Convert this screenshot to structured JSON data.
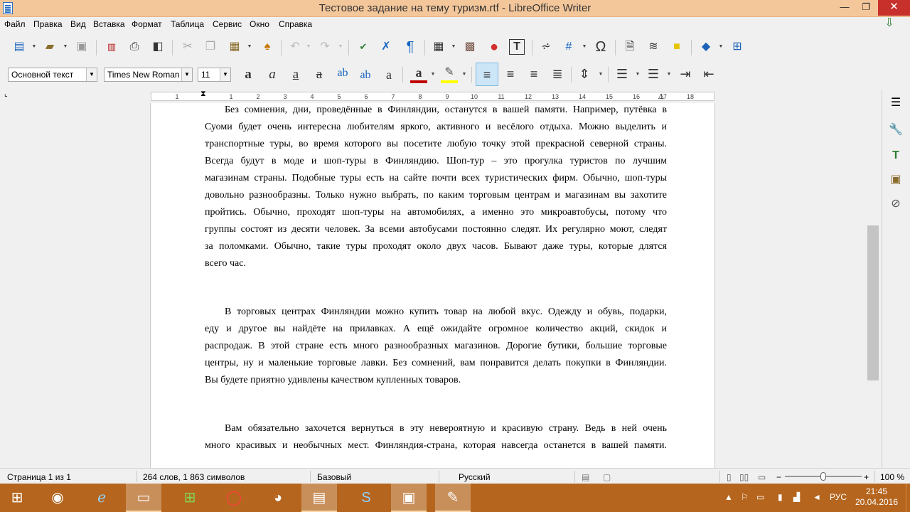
{
  "window": {
    "title": "Тестовое задание на тему туризм.rtf - LibreOffice Writer",
    "minimize_glyph": "—",
    "restore_glyph": "❐",
    "close_glyph": "✕"
  },
  "menu": [
    "Файл",
    "Правка",
    "Вид",
    "Вставка",
    "Формат",
    "Таблица",
    "Сервис",
    "Окно",
    "Справка"
  ],
  "toolbar": {
    "icons": [
      "new-icon",
      "open-icon",
      "save-icon",
      "export-pdf-icon",
      "print-icon",
      "print-preview-icon",
      "cut-icon",
      "copy-icon",
      "paste-icon",
      "clone-formatting-icon",
      "undo-icon",
      "redo-icon",
      "spellcheck-icon",
      "autocorrect-icon",
      "formatting-marks-icon",
      "table-icon",
      "image-icon",
      "chart-icon",
      "textbox-icon",
      "page-break-icon",
      "field-icon",
      "special-character-icon",
      "hyperlink-icon",
      "footnote-icon",
      "comment-icon",
      "track-changes-icon",
      "shapes-icon",
      "basic-shapes-icon"
    ]
  },
  "format": {
    "paragraph_style": "Основной текст",
    "font_name": "Times New Roman",
    "font_size": "11",
    "text_color": "#c00000",
    "highlight_color": "#ffff00"
  },
  "ruler": {
    "numbers": [
      "1",
      "1",
      "2",
      "3",
      "4",
      "5",
      "6",
      "7",
      "8",
      "9",
      "10",
      "11",
      "12",
      "13",
      "14",
      "15",
      "16",
      "17",
      "18"
    ]
  },
  "document": {
    "para1": [
      "Без сомнения, дни, проведённые в Финляндии, останутся в вашей памяти. Например, путёвка в",
      "Суоми будет очень интересна любителям яркого, активного и весёлого отдыха. Можно выделить и",
      "транспортные туры, во время которого вы посетите любую точку этой прекрасной северной страны.",
      "Всегда будут в моде и шоп-туры в Финляндию. Шоп-тур – это прогулка туристов по лучшим",
      "магазинам страны. Подобные туры есть на сайте почти всех туристических фирм. Обычно, шоп-туры",
      "довольно разнообразны. Только нужно выбрать, по каким торговым центрам и магазинам вы захотите",
      "пройтись. Обычно, проходят шоп-туры на автомобилях, а именно это микроавтобусы, потому что",
      "группы состоят из десяти человек. За всеми автобусами постоянно следят. Их регулярно моют, следят",
      "за поломками. Обычно, такие туры проходят около двух часов. Бывают даже туры, которые длятся",
      "всего час."
    ],
    "para2": [
      "В торговых центрах Финляндии можно купить товар на любой вкус. Одежду и обувь, подарки,",
      "еду и другое вы найдёте на прилавках. А ещё ожидайте огромное количество акций, скидок и",
      "распродаж. В этой стране есть много разнообразных магазинов. Дорогие бутики, большие торговые",
      "центры, ну и маленькие торговые лавки. Без сомнений, вам понравится делать покупки в Финляндии.",
      "Вы будете приятно удивлены качеством купленных товаров."
    ],
    "para3": [
      "Вам обязательно захочется вернуться в эту невероятную и красивую страну. Ведь в ней очень",
      "много красивых и необычных мест. Финляндия-страна, которая навсегда останется в вашей памяти."
    ]
  },
  "status": {
    "page": "Страница 1 из 1",
    "words": "264 слов, 1 863 символов",
    "style": "Базовый",
    "language": "Русский",
    "zoom": "100 %",
    "zoom_level": 0.5
  },
  "taskbar": {
    "apps": [
      "start-icon",
      "firefox-icon",
      "internet-explorer-icon",
      "file-explorer-icon",
      "store-icon",
      "opera-icon",
      "chrome-icon",
      "libreoffice-writer-icon",
      "skype-icon",
      "photo-viewer-icon",
      "paint-icon"
    ],
    "language": "РУС",
    "time": "21:45",
    "date": "20.04.2016"
  }
}
